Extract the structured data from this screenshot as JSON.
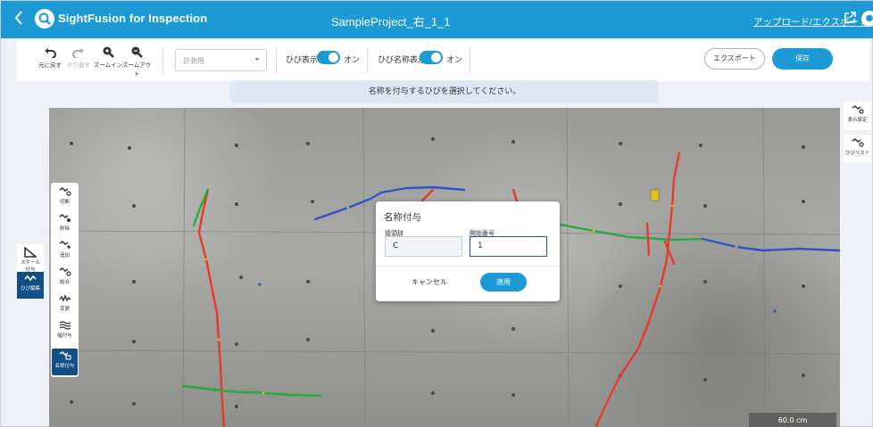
{
  "header": {
    "app_name": "SightFusion for Inspection",
    "project_name": "SampleProject_右_1_1",
    "upload_export_link": "アップロード/エクスポート",
    "back_icon": "chevron-left-icon",
    "external_icon": "external-link-icon",
    "user_icon": "user-icon"
  },
  "toolbar": {
    "undo": "元に戻す",
    "redo": "やり直す",
    "zoom_in": "ズームイン",
    "zoom_out": "ズームアウト",
    "select_placeholder": "計測用",
    "crack_display_label": "ひび表示",
    "crack_display_value": "オン",
    "crack_name_display_label": "ひび名称表示",
    "crack_name_display_value": "オン",
    "export": "エクスポート",
    "save": "保存"
  },
  "banner": {
    "message": "名称を付与するひびを選択してください。"
  },
  "left_side": [
    {
      "label": "スケール\n付与",
      "icon": "ruler-triangle-icon"
    },
    {
      "label": "ひび編集",
      "icon": "crack-edit-icon",
      "active": true
    }
  ],
  "crack_tools": [
    {
      "label": "切断",
      "icon": "cut-crack-icon"
    },
    {
      "label": "削除",
      "icon": "delete-crack-icon"
    },
    {
      "label": "追加",
      "icon": "add-crack-icon"
    },
    {
      "label": "結合",
      "icon": "join-crack-icon"
    },
    {
      "label": "変更",
      "icon": "change-crack-icon"
    },
    {
      "label": "幅付与",
      "icon": "width-crack-icon"
    },
    {
      "label": "名称付与",
      "icon": "name-crack-icon",
      "active": true
    }
  ],
  "right_tools": [
    {
      "label": "表示設定",
      "icon": "display-settings-icon"
    },
    {
      "label": "ひびリスト",
      "icon": "crack-list-icon"
    }
  ],
  "scale": {
    "value": "60.0 cm"
  },
  "dialog": {
    "title": "名称付与",
    "prefix_label": "接頭辞",
    "prefix_value": "C",
    "start_number_label": "開始番号",
    "start_number_value": "1",
    "cancel": "キャンセル",
    "apply": "適用"
  },
  "colors": {
    "primary": "#1c9ad6",
    "active_tool": "#114f86",
    "crack_red": "#e8392a",
    "crack_blue": "#2f55c8",
    "crack_green": "#2aaa3a"
  }
}
